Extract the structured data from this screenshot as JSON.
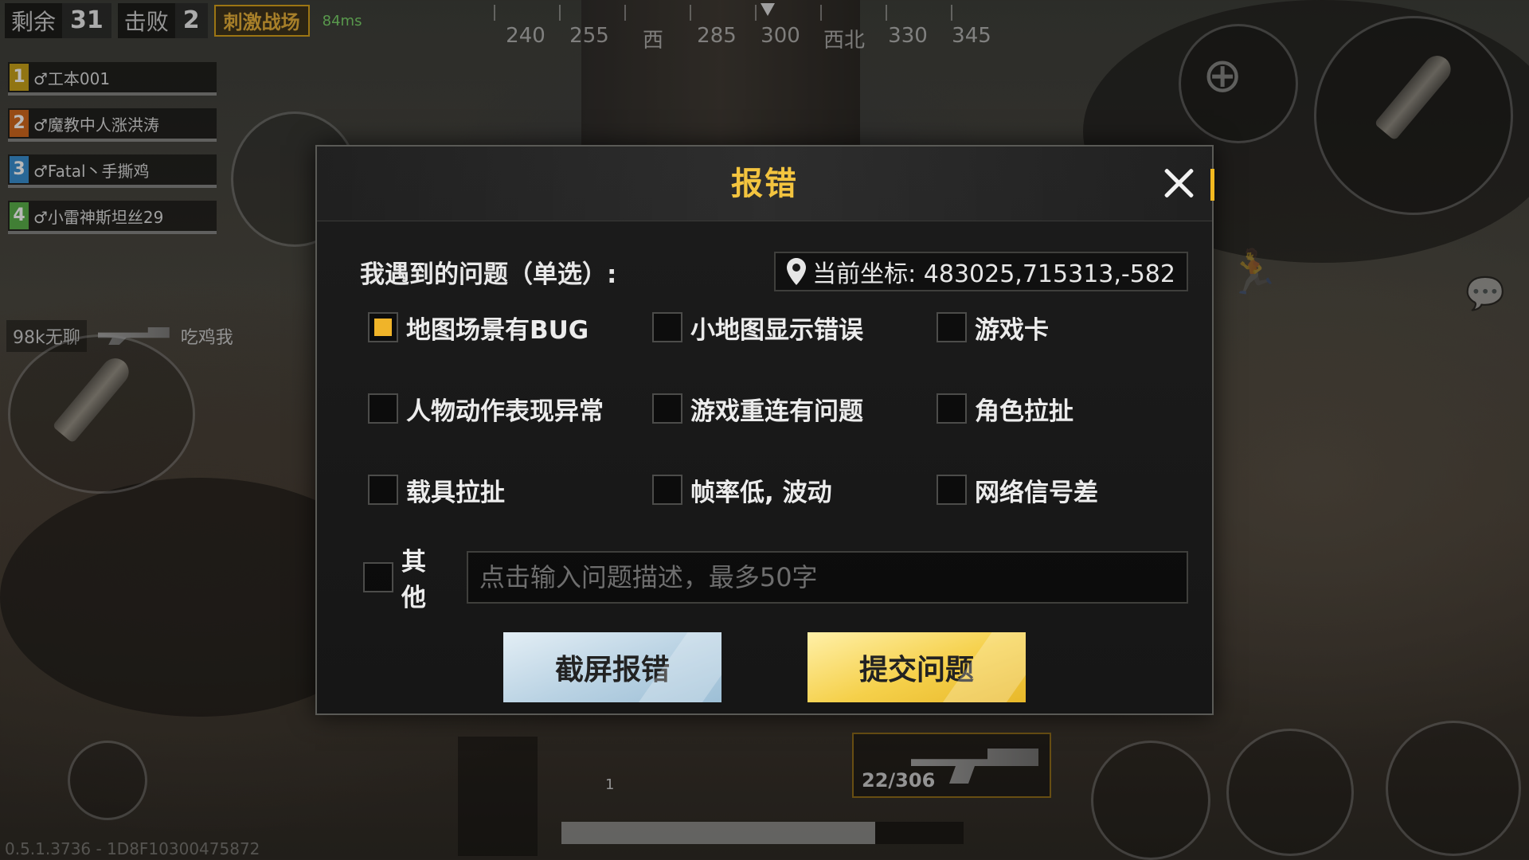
{
  "hud": {
    "remaining_label": "剩余",
    "remaining_value": "31",
    "kills_label": "击败",
    "kills_value": "2",
    "mode_badge": "刺激战场",
    "ping": "84ms",
    "compass": [
      "240",
      "255",
      "西",
      "285",
      "300",
      "西北",
      "330",
      "345"
    ],
    "team": [
      {
        "num": "1",
        "name": "♂工本001",
        "color": "#c9a21a"
      },
      {
        "num": "2",
        "name": "♂魔教中人涨洪涛",
        "color": "#d2691e"
      },
      {
        "num": "3",
        "name": "♂Fatal丶手撕鸡",
        "color": "#3a8fd0"
      },
      {
        "num": "4",
        "name": "♂小雷神斯坦丝29",
        "color": "#5bb04a"
      }
    ],
    "kill_feed": {
      "killer": "98k无聊",
      "victim": "吃鸡我"
    },
    "right_feed_name": "魔教中人涨洪涛",
    "ammo": "22/306",
    "grenade_count": "1",
    "health_fraction": 0.78,
    "version": "0.5.1.3736 - 1D8F10300475872"
  },
  "dialog": {
    "title": "报错",
    "question_label": "我遇到的问题（单选）:",
    "coord_text": "当前坐标: 483025,715313,-582",
    "options": [
      {
        "label": "地图场景有BUG",
        "checked": true
      },
      {
        "label": "小地图显示错误",
        "checked": false
      },
      {
        "label": "游戏卡",
        "checked": false
      },
      {
        "label": "人物动作表现异常",
        "checked": false
      },
      {
        "label": "游戏重连有问题",
        "checked": false
      },
      {
        "label": "角色拉扯",
        "checked": false
      },
      {
        "label": "载具拉扯",
        "checked": false
      },
      {
        "label": "帧率低, 波动",
        "checked": false
      },
      {
        "label": "网络信号差",
        "checked": false
      }
    ],
    "other_label": "其他",
    "other_placeholder": "点击输入问题描述，最多50字",
    "other_value": "",
    "screenshot_button": "截屏报错",
    "submit_button": "提交问题",
    "accent_color": "#f3c43f"
  }
}
